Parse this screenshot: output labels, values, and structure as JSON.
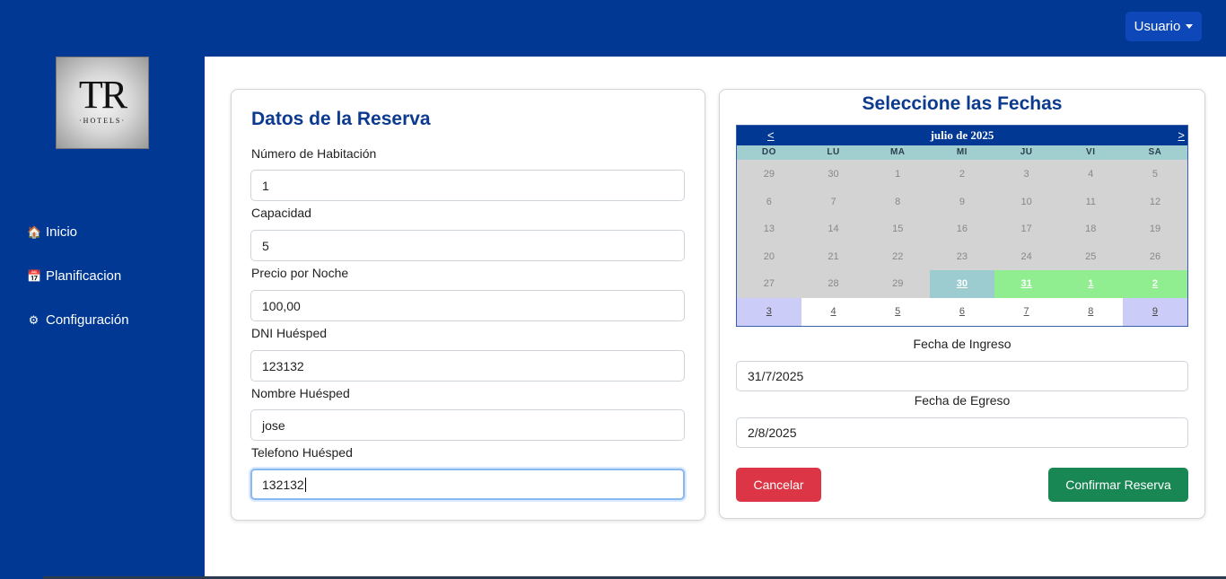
{
  "header": {
    "user_label": "Usuario"
  },
  "sidebar": {
    "logo_mark": "TR",
    "logo_sub": "·HOTELS·",
    "items": [
      {
        "icon": "home-icon",
        "label": "Inicio"
      },
      {
        "icon": "calendar-icon",
        "label": "Planificacion"
      },
      {
        "icon": "gear-icon",
        "label": "Configuración"
      }
    ]
  },
  "form": {
    "title": "Datos de la Reserva",
    "fields": [
      {
        "label": "Número de Habitación",
        "value": "1"
      },
      {
        "label": "Capacidad",
        "value": "5"
      },
      {
        "label": "Precio por Noche",
        "value": "100,00"
      },
      {
        "label": "DNI Huésped",
        "value": "123132"
      },
      {
        "label": "Nombre Huésped",
        "value": "jose"
      },
      {
        "label": "Telefono Huésped",
        "value": "132132"
      }
    ]
  },
  "dates": {
    "title": "Seleccione las Fechas",
    "calendar": {
      "prev": "<",
      "next": ">",
      "month": "julio de 2025",
      "weekdays": [
        "DO",
        "LU",
        "MA",
        "MI",
        "JU",
        "VI",
        "SA"
      ],
      "weeks": [
        [
          "29",
          "30",
          "1",
          "2",
          "3",
          "4",
          "5"
        ],
        [
          "6",
          "7",
          "8",
          "9",
          "10",
          "11",
          "12"
        ],
        [
          "13",
          "14",
          "15",
          "16",
          "17",
          "18",
          "19"
        ],
        [
          "20",
          "21",
          "22",
          "23",
          "24",
          "25",
          "26"
        ],
        [
          "27",
          "28",
          "29",
          "30",
          "31",
          "1",
          "2"
        ],
        [
          "3",
          "4",
          "5",
          "6",
          "7",
          "8",
          "9"
        ]
      ]
    },
    "checkin_label": "Fecha de Ingreso",
    "checkin_value": "31/7/2025",
    "checkout_label": "Fecha de Egreso",
    "checkout_value": "2/8/2025"
  },
  "actions": {
    "cancel": "Cancelar",
    "confirm": "Confirmar Reserva"
  },
  "colors": {
    "primary": "#003893",
    "danger": "#dc3545",
    "success": "#198754",
    "selected_range": "#90ee90"
  }
}
